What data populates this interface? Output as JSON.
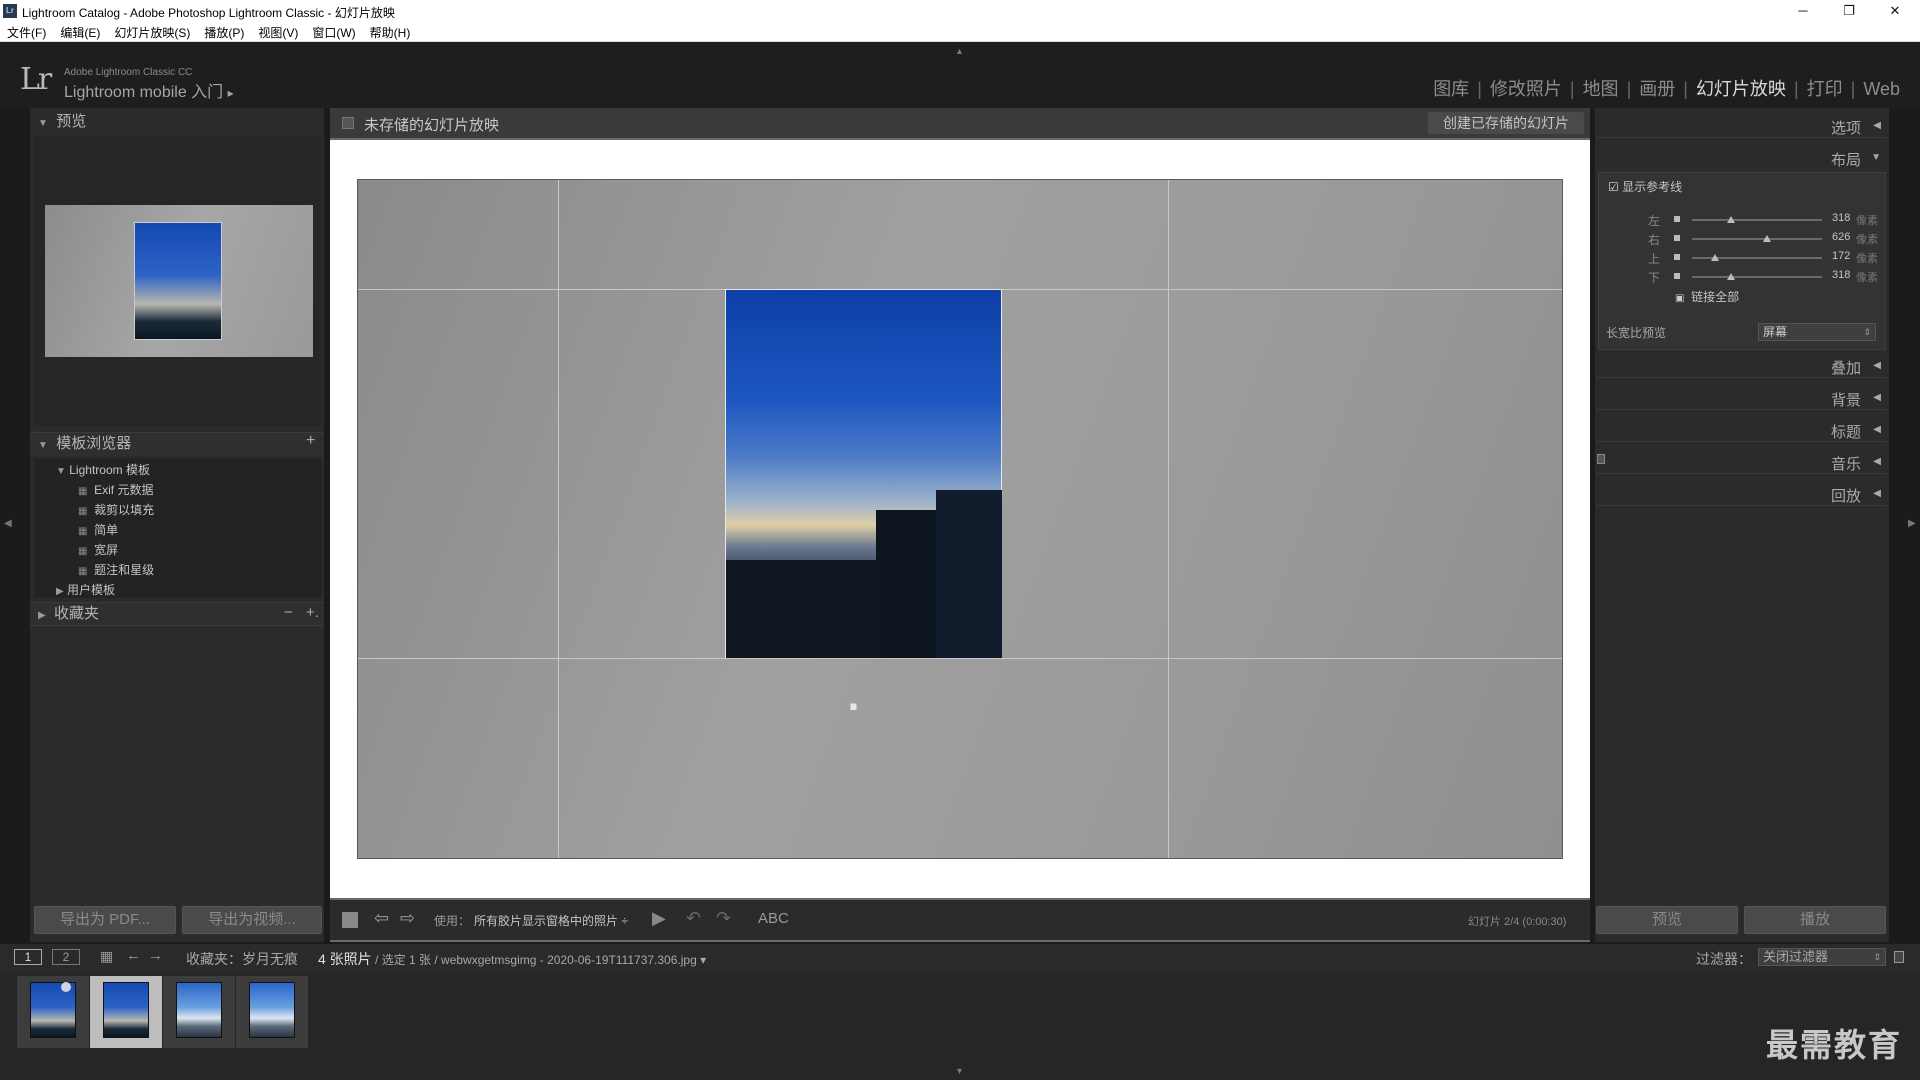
{
  "window": {
    "title": "Lightroom Catalog - Adobe Photoshop Lightroom Classic - 幻灯片放映",
    "app_icon": "Lr",
    "minimize": "─",
    "restore": "❐",
    "close": "✕"
  },
  "menu": [
    "文件(F)",
    "编辑(E)",
    "幻灯片放映(S)",
    "播放(P)",
    "视图(V)",
    "窗口(W)",
    "帮助(H)"
  ],
  "identity": {
    "logo": "Lr",
    "product": "Adobe Lightroom Classic CC",
    "mobile": "Lightroom mobile 入门",
    "arrow": "▸"
  },
  "modules": {
    "items": [
      "图库",
      "修改照片",
      "地图",
      "画册",
      "幻灯片放映",
      "打印",
      "Web"
    ],
    "active": "幻灯片放映",
    "separator": "|"
  },
  "left_panel": {
    "preview_title": "预览",
    "templates_title": "模板浏览器",
    "templates_add": "+",
    "template_group": "Lightroom 模板",
    "templates": [
      "Exif 元数据",
      "裁剪以填充",
      "简单",
      "宽屏",
      "题注和星级"
    ],
    "user_templates": "用户模板",
    "collections_title": "收藏夹",
    "collections_minus": "−",
    "collections_plus": "+.",
    "export_pdf": "导出为 PDF...",
    "export_video": "导出为视频..."
  },
  "center": {
    "show_title": "未存储的幻灯片放映",
    "create_saved": "创建已存储的幻灯片",
    "drag_handle": "IIII",
    "use_label": "使用：",
    "use_value": "所有胶片显示窗格中的照片 ÷",
    "abc": "ABC",
    "slide_info": "幻灯片 2/4 (0:00:30)"
  },
  "right_panel": {
    "options": "选项",
    "layout": "布局",
    "show_guides": "显示参考线",
    "guides": [
      {
        "label": "左",
        "value": "318",
        "unit": "像素",
        "pos": 0.3
      },
      {
        "label": "右",
        "value": "626",
        "unit": "像素",
        "pos": 0.58
      },
      {
        "label": "上",
        "value": "172",
        "unit": "像素",
        "pos": 0.18
      },
      {
        "label": "下",
        "value": "318",
        "unit": "像素",
        "pos": 0.3
      }
    ],
    "link_all": "链接全部",
    "aspect_label": "长宽比预览",
    "aspect_value": "屏幕",
    "sections": [
      "叠加",
      "背景",
      "标题",
      "音乐",
      "回放"
    ],
    "preview_button": "预览",
    "play_button": "播放"
  },
  "filmstrip": {
    "page1": "1",
    "page2": "2",
    "source": "收藏夹：岁月无痕",
    "count": "4 张照片",
    "selection": " / 选定 1 张 / webwxgetmsgimg - 2020-06-19T111737.306.jpg ▾",
    "filter_label": "过滤器：",
    "filter_value": "关闭过滤器"
  },
  "watermark": "最需教育"
}
